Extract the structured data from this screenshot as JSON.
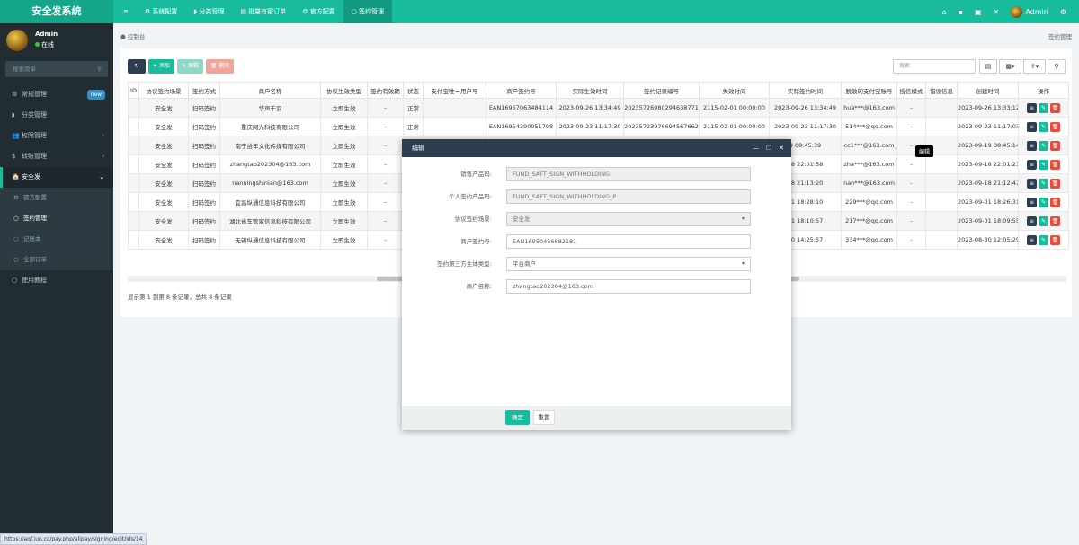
{
  "brand": "安全发系统",
  "nav": [
    {
      "icon": "≡",
      "label": ""
    },
    {
      "icon": "⚙",
      "label": "系统配置"
    },
    {
      "icon": "◗",
      "label": "分类管理"
    },
    {
      "icon": "▤",
      "label": "批量有密订单"
    },
    {
      "icon": "⚙",
      "label": "官方配置"
    },
    {
      "icon": "○",
      "label": "签约管理"
    }
  ],
  "topright": {
    "user": "Admin"
  },
  "user": {
    "name": "Admin",
    "status": "在线"
  },
  "sidebar_search": "搜索菜单",
  "menu": [
    {
      "icon": "⚙",
      "label": "常规管理",
      "badge": "new"
    },
    {
      "icon": "◗",
      "label": "分类管理"
    },
    {
      "icon": "👥",
      "label": "权限管理",
      "arrow": "‹"
    },
    {
      "icon": "$",
      "label": "转账管理",
      "arrow": "‹"
    },
    {
      "icon": "🏠",
      "label": "安全发",
      "arrow": "⌄"
    }
  ],
  "submenu": [
    "官方配置",
    "签约管理",
    "记账本",
    "全部订单"
  ],
  "menu_last": "使用教程",
  "breadcrumb": "控制台",
  "breadcrumb_right": "签约管理",
  "toolbar": {
    "refresh": "↻",
    "add": "+ 添加",
    "edit": "✎ 编辑",
    "del": "🗑 删除"
  },
  "table_search": "搜索",
  "columns": [
    "ID",
    "协议签约场景",
    "签约方式",
    "商户名称",
    "协议生效类型",
    "签约有效期",
    "状态",
    "支付宝唯一用户号",
    "商户签约号",
    "实际生效时间",
    "签约记录编号",
    "失效时间",
    "实际签约时间",
    "脱敏的支付宝账号",
    "授信模式",
    "错误信息",
    "创建时间",
    "操作"
  ],
  "rows": [
    [
      "",
      "安全发",
      "扫码签约",
      "华声千羽",
      "立即生效",
      "-",
      "正常",
      "",
      "EAN16957063484114",
      "2023-09-26 13:34:49",
      "20235726980294638771",
      "2115-02-01 00:00:00",
      "2023-09-26 13:34:49",
      "hua***@163.com",
      "-",
      "",
      "2023-09-26 13:33:12"
    ],
    [
      "",
      "安全发",
      "扫码签约",
      "重庆网光科技有限公司",
      "立即生效",
      "-",
      "正常",
      "",
      "EAN16954390051798",
      "2023-09-23 11:17:30",
      "20235723976694567662",
      "2115-02-01 00:00:00",
      "2023-09-23 11:17:30",
      "514***@qq.com",
      "-",
      "",
      "2023-09-23 11:17:03"
    ],
    [
      "",
      "安全发",
      "扫码签约",
      "南宁拾年文化传媒有限公司",
      "立即生效",
      "-",
      "",
      "",
      "",
      "",
      "",
      "",
      "9 08:45:39",
      "cc1***@163.com",
      "-",
      "",
      "2023-09-19 08:45:14"
    ],
    [
      "",
      "安全发",
      "扫码签约",
      "zhangtao202304@163.com",
      "立即生效",
      "-",
      "",
      "",
      "",
      "",
      "",
      "",
      "18 22:01:58",
      "zha***@163.com",
      "-",
      "",
      "2023-09-18 22:01:23"
    ],
    [
      "",
      "安全发",
      "扫码签约",
      "nanningshinian@163.com",
      "立即生效",
      "-",
      "",
      "",
      "",
      "",
      "",
      "",
      "18 21:13:20",
      "nan***@163.com",
      "-",
      "",
      "2023-09-18 21:12:47"
    ],
    [
      "",
      "安全发",
      "扫码签约",
      "宜昌纵通信息科技有限公司",
      "立即生效",
      "-",
      "",
      "",
      "",
      "",
      "",
      "",
      "01 18:28:10",
      "229***@qq.com",
      "-",
      "",
      "2023-09-01 18:26:31"
    ],
    [
      "",
      "安全发",
      "扫码签约",
      "湖北省车管家信息科技有限公司",
      "立即生效",
      "-",
      "",
      "",
      "",
      "",
      "",
      "",
      "01 18:10:57",
      "217***@qq.com",
      "-",
      "",
      "2023-09-01 18:09:55"
    ],
    [
      "",
      "安全发",
      "扫码签约",
      "无锡纵通信息科技有限公司",
      "立即生效",
      "-",
      "",
      "",
      "",
      "",
      "",
      "",
      "30 14:25:57",
      "334***@qq.com",
      "-",
      "",
      "2023-08-30 12:05:29"
    ]
  ],
  "table_footer": "显示第 1 到第 8 条记录，总共 8 条记录",
  "tooltip": "编辑",
  "modal": {
    "title": "编辑",
    "fields": [
      {
        "label": "销售产品码:",
        "value": "FUND_SAFT_SIGN_WITHHOLDING",
        "ro": true
      },
      {
        "label": "个人签约产品码:",
        "value": "FUND_SAFT_SIGN_WITHHOLDING_P",
        "ro": true
      },
      {
        "label": "协议签约场景:",
        "value": "安全发",
        "ro": true,
        "select": true
      },
      {
        "label": "商户签约号:",
        "value": "EAN16950456682181"
      },
      {
        "label": "签约第三方主体类型:",
        "value": "平台商户",
        "select": true
      },
      {
        "label": "商户名称:",
        "value": "zhangtao202304@163.com"
      }
    ],
    "ok": "确定",
    "reset": "重置"
  },
  "status_url": "https://aqf.iun.cc/pay.php/alipay/signing/edit/ids/14"
}
